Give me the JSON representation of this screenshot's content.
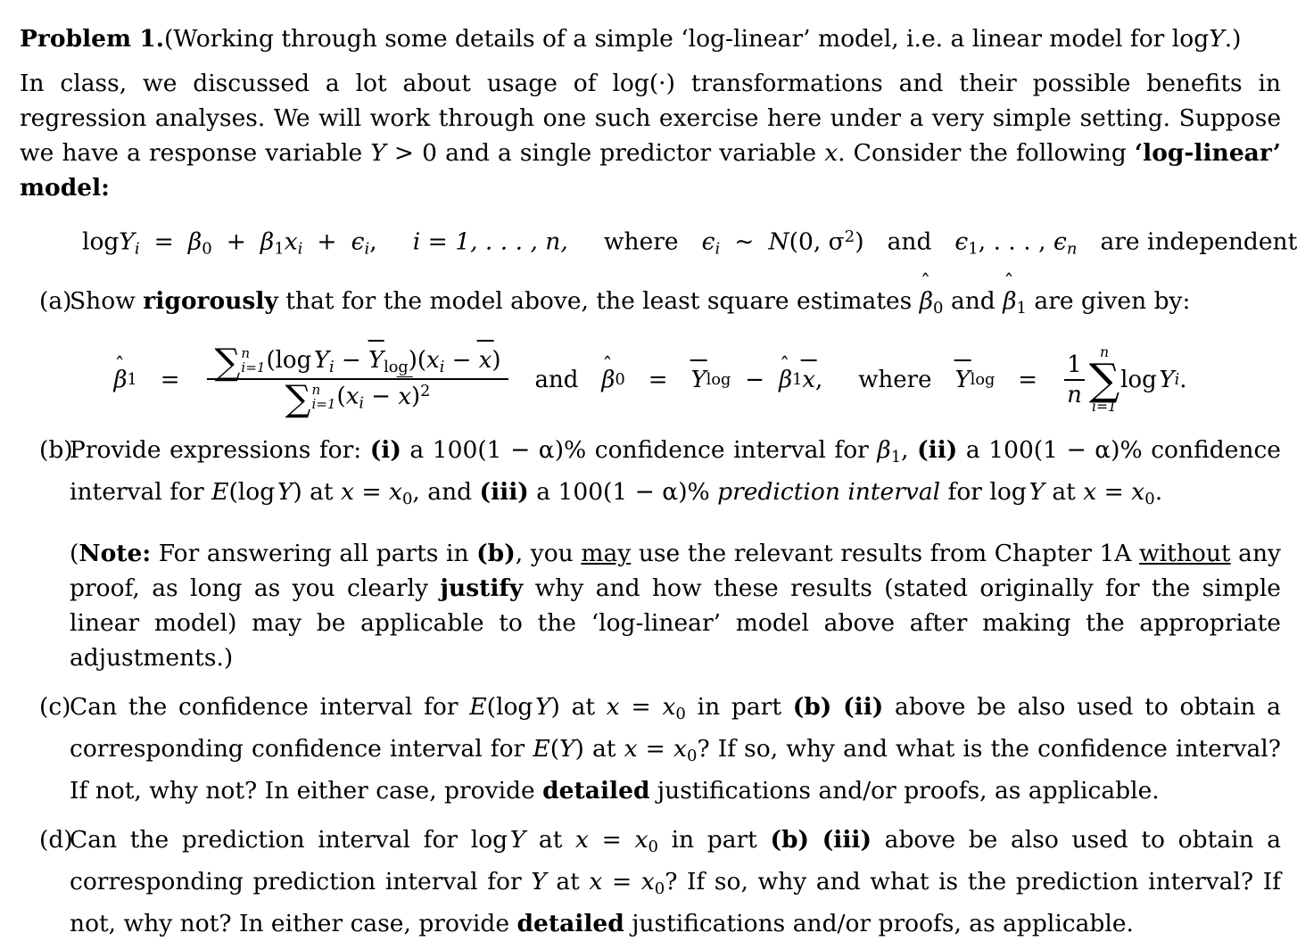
{
  "document": {
    "problem_label": "Problem 1.",
    "title_rest_1": "(Working through some details of a simple ‘log-linear’ model, i.e. a linear model for ",
    "title_math_log": "log",
    "title_math_Y": "Y",
    "title_rest_2": ".)",
    "intro": {
      "s1": "In class, we discussed a lot about usage of ",
      "m_log": "log",
      "m_dot": "(·)",
      "s2": " transformations and their possible benefits in regression analyses. We will work through one such exercise here under a very simple setting. Suppose we have a response variable ",
      "m_Y": "Y",
      "m_gt0": "> 0",
      "s3": " and a single predictor variable ",
      "m_x": "x",
      "s4": ". Consider the following ",
      "bold_tail": "‘log-linear’ model:"
    },
    "model_equation": {
      "log": "log",
      "Y": "Y",
      "i": "i",
      "eq": "=",
      "beta": "β",
      "zero": "0",
      "plus": "+",
      "one": "1",
      "x": "x",
      "eps": "ϵ",
      "comma": ",",
      "i_eq": "i = 1, . . . , n,",
      "where": "where",
      "tilde": "∼",
      "N": "N",
      "normal_args": "(0, σ",
      "sup2": "2",
      "close": ")",
      "and": "and",
      "eps_list": "ϵ",
      "eps_sub1": "1",
      "eps_dots": ", . . . , ",
      "eps_subn": "n",
      "independent": "are independent."
    },
    "items": [
      {
        "label": "(a)",
        "text_1": "Show ",
        "bold_1": "rigorously",
        "text_2": " that for the model above, the least square estimates ",
        "beta0": "β",
        "sub0": "0",
        "text_3": " and ",
        "beta1": "β",
        "sub1": "1",
        "text_4": " are given by:"
      }
    ],
    "formula_a": {
      "beta_hat": "β",
      "sub_1": "1",
      "equals": "=",
      "num_sum_sigma": "∑",
      "num_sum_top": "n",
      "num_sum_bot": "i=1",
      "num_body_1": "(",
      "num_log": "log",
      "num_Y": "Y",
      "num_Y_sub": "i",
      "num_minus": "−",
      "num_Ybar": "Y",
      "num_Ybar_sub": "log",
      "num_body_2": ")(",
      "num_x": "x",
      "num_x_sub": "i",
      "num_minus2": "−",
      "num_xbar": "x",
      "num_body_3": ")",
      "den_sum_sigma": "∑",
      "den_sum_top": "n",
      "den_sum_bot": "i=1",
      "den_body_1": "(",
      "den_x": "x",
      "den_x_sub": "i",
      "den_minus": "−",
      "den_xbar": "x",
      "den_body_2": ")",
      "den_sup": "2",
      "and": "and",
      "beta0_hat": "β",
      "sub_0": "0",
      "equals2": "=",
      "Ybar2": "Y",
      "Ybar2_sub": "log",
      "minus3": "−",
      "beta1_hat2": "β",
      "beta1_hat2_sub": "1",
      "xbar2": "x",
      "comma": ",",
      "where": "where",
      "Ybar3": "Y",
      "Ybar3_sub": "log",
      "equals3": "=",
      "frac_num": "1",
      "frac_den": "n",
      "sum2_sigma": "∑",
      "sum2_top": "n",
      "sum2_bot": "i=1",
      "log2": "log",
      "Y2": "Y",
      "Y2_sub": "i",
      "period": "."
    },
    "item_b": {
      "label": "(b)",
      "t1": "Provide expressions for: ",
      "b1": "(i)",
      "t2": " a ",
      "m1": "100(1 − α)%",
      "t3": " confidence interval for ",
      "m_beta1": "β",
      "m_beta1_sub": "1",
      "t4": ", ",
      "b2": "(ii)",
      "t5": " a ",
      "m2": "100(1 − α)%",
      "t6": " confidence interval for ",
      "m_E": "E",
      "m_Elog": "(log",
      "m_EY": "Y",
      "m_Eclose": ")",
      "t7": " at ",
      "m_x": "x",
      "m_eq": "=",
      "m_x0": "x",
      "m_x0_sub": "0",
      "t8": ", and ",
      "b3": "(iii)",
      "t9": " a ",
      "m3": "100(1 − α)%",
      "t10": " ",
      "i1": "prediction interval",
      "t11": " for ",
      "m_log2": "log",
      "m_Y2": "Y",
      "t12": " at ",
      "m_x2": "x",
      "m_eq2": "=",
      "m_x02": "x",
      "m_x02_sub": "0",
      "t13": "."
    },
    "note": {
      "open": "(",
      "bold_note": "Note:",
      "t1": " For answering all parts in ",
      "b_b": "(b)",
      "t2": ", you ",
      "u_may": "may",
      "t3": " use the relevant results from Chapter 1A ",
      "u_without": "without",
      "t4": " any proof, as long as you clearly ",
      "b_justify": "justify",
      "t5": " why and how these results (stated originally for the simple linear model) may be applicable to the ‘log-linear’ model above after making the appropriate adjustments.)"
    },
    "item_c": {
      "label": "(c)",
      "t1": "Can the confidence interval for ",
      "m_E": "E",
      "m_open": "(log",
      "m_Y": "Y",
      "m_close": ")",
      "t2": " at ",
      "m_x": "x",
      "m_eq": "=",
      "m_x0": "x",
      "m_x0_sub": "0",
      "t3": " in part ",
      "b_b": "(b)",
      "t4": " ",
      "b_ii": "(ii)",
      "t5": " above be also used to obtain a corresponding confidence interval for ",
      "m_E2": "E",
      "m_open2": "(",
      "m_Y2": "Y",
      "m_close2": ")",
      "t6": " at ",
      "m_x2": "x",
      "m_eq2": "=",
      "m_x02": "x",
      "m_x02_sub": "0",
      "t7": "? If so, why and what is the confidence interval? If not, why not? In either case, provide ",
      "b_detailed": "detailed",
      "t8": " justifications and/or proofs, as applicable."
    },
    "item_d": {
      "label": "(d)",
      "t1": "Can the prediction interval for ",
      "m_log": "log",
      "m_Y": "Y",
      "t2": " at ",
      "m_x": "x",
      "m_eq": "=",
      "m_x0": "x",
      "m_x0_sub": "0",
      "t3": " in part ",
      "b_b": "(b)",
      "t4": " ",
      "b_iii": "(iii)",
      "t5": " above be also used to obtain a corresponding prediction interval for ",
      "m_Y2": "Y",
      "t6": " at ",
      "m_x2": "x",
      "m_eq2": "=",
      "m_x02": "x",
      "m_x02_sub": "0",
      "t7": "? If so, why and what is the prediction interval? If not, why not? In either case, provide ",
      "b_detailed": "detailed",
      "t8": " justifications and/or proofs, as applicable."
    },
    "colors": {
      "text": "#000000",
      "background": "#ffffff"
    }
  }
}
